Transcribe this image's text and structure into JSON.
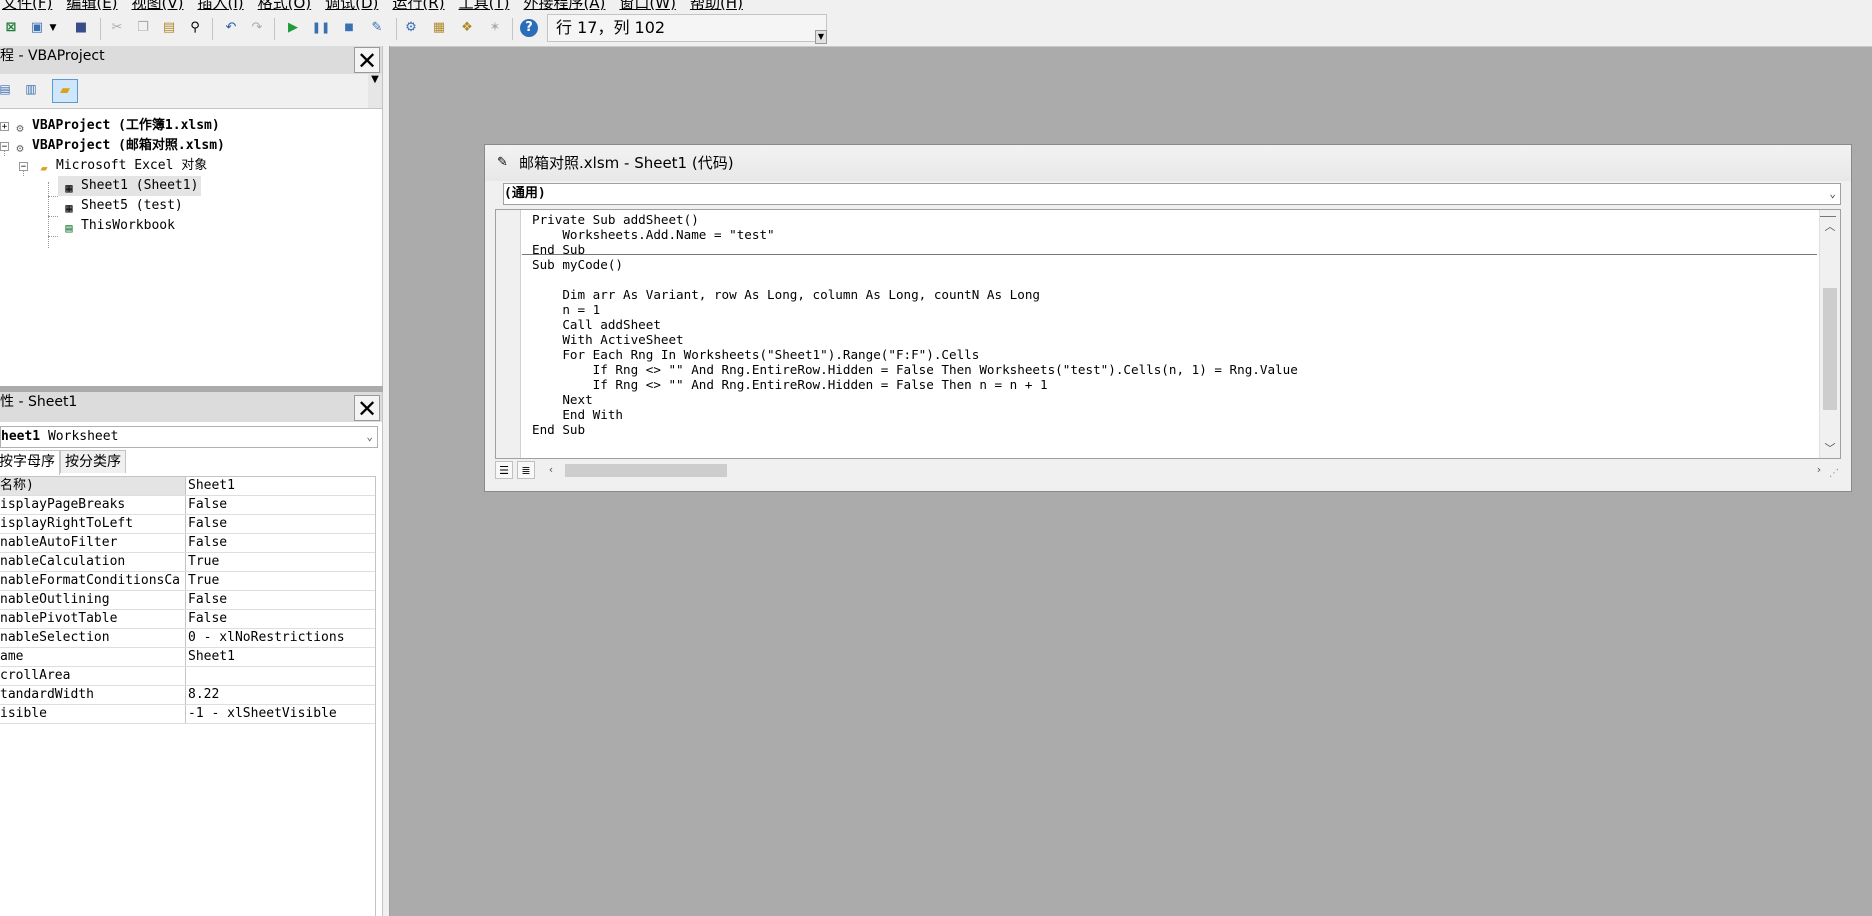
{
  "menubar": {
    "items": [
      "文件(F)",
      "编辑(E)",
      "视图(V)",
      "插入(I)",
      "格式(O)",
      "调试(D)",
      "运行(R)",
      "工具(T)",
      "外接程序(A)",
      "窗口(W)",
      "帮助(H)"
    ]
  },
  "toolbar": {
    "icons": [
      "excel-icon",
      "insert-userform-icon",
      "dropdown-arrow-icon",
      "save-icon",
      "cut-icon",
      "copy-icon",
      "paste-icon",
      "find-icon",
      "undo-icon",
      "redo-icon",
      "run-icon",
      "break-icon",
      "reset-icon",
      "design-mode-icon",
      "project-explorer-icon",
      "properties-window-icon",
      "object-browser-icon",
      "toolbox-icon",
      "help-icon"
    ],
    "position_text": "行 17，列 102"
  },
  "project_pane": {
    "title": "程 - VBAProject",
    "close_label": "✕",
    "tree": [
      {
        "label": "VBAProject (工作簿1.xlsm)",
        "bold": true,
        "expander": "+"
      },
      {
        "label": "VBAProject (邮箱对照.xlsm)",
        "bold": true,
        "expander": "−"
      },
      {
        "label": "Microsoft Excel 对象",
        "bold": false,
        "expander": "−"
      },
      {
        "label": "Sheet1 (Sheet1)",
        "bold": false,
        "selected": true
      },
      {
        "label": "Sheet5 (test)",
        "bold": false
      },
      {
        "label": "ThisWorkbook",
        "bold": false
      }
    ]
  },
  "props_pane": {
    "title": "性 - Sheet1",
    "close_label": "✕",
    "object_name": "heet1",
    "object_type": " Worksheet",
    "tabs": [
      "按字母序",
      "按分类序"
    ],
    "rows": [
      {
        "name": "名称)",
        "value": "Sheet1"
      },
      {
        "name": "isplayPageBreaks",
        "value": "False"
      },
      {
        "name": "isplayRightToLeft",
        "value": "False"
      },
      {
        "name": "nableAutoFilter",
        "value": "False"
      },
      {
        "name": "nableCalculation",
        "value": "True"
      },
      {
        "name": "nableFormatConditionsCa",
        "value": "True"
      },
      {
        "name": "nableOutlining",
        "value": "False"
      },
      {
        "name": "nablePivotTable",
        "value": "False"
      },
      {
        "name": "nableSelection",
        "value": "0 - xlNoRestrictions"
      },
      {
        "name": "ame",
        "value": "Sheet1"
      },
      {
        "name": "crollArea",
        "value": ""
      },
      {
        "name": "tandardWidth",
        "value": "8.22"
      },
      {
        "name": "isible",
        "value": "-1 - xlSheetVisible"
      }
    ]
  },
  "code_window": {
    "title": "邮箱对照.xlsm - Sheet1 (代码)",
    "proc_combo": "(通用)",
    "lines": [
      "Private Sub addSheet()",
      "    Worksheets.Add.Name = \"test\"",
      "End Sub",
      "Sub myCode()",
      "",
      "    Dim arr As Variant, row As Long, column As Long, countN As Long",
      "    n = 1",
      "    Call addSheet",
      "    With ActiveSheet",
      "    For Each Rng In Worksheets(\"Sheet1\").Range(\"F:F\").Cells",
      "        If Rng <> \"\" And Rng.EntireRow.Hidden = False Then Worksheets(\"test\").Cells(n, 1) = Rng.Value",
      "        If Rng <> \"\" And Rng.EntireRow.Hidden = False Then n = n + 1",
      "    Next",
      "    End With",
      "End Sub"
    ]
  }
}
